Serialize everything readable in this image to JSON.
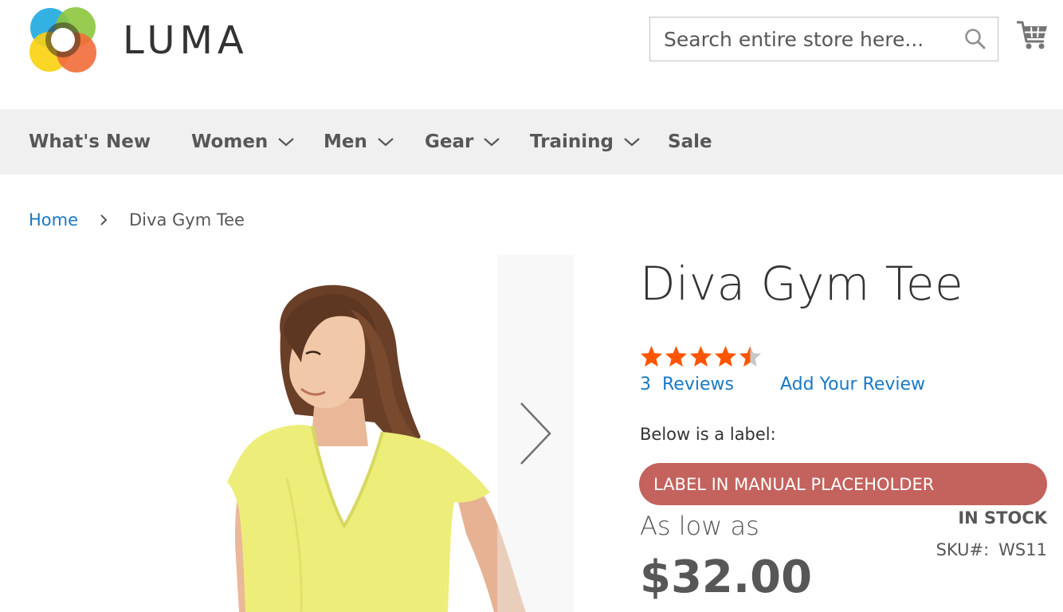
{
  "header": {
    "logo_text": "LUMA",
    "search": {
      "placeholder": "Search entire store here...",
      "value": ""
    },
    "icons": {
      "search": "search-icon",
      "cart": "shopping-cart-icon",
      "logo": "luma-logo-icon"
    }
  },
  "nav": {
    "items": [
      {
        "label": "What's New",
        "has_dropdown": false
      },
      {
        "label": "Women",
        "has_dropdown": true
      },
      {
        "label": "Men",
        "has_dropdown": true
      },
      {
        "label": "Gear",
        "has_dropdown": true
      },
      {
        "label": "Training",
        "has_dropdown": true
      },
      {
        "label": "Sale",
        "has_dropdown": false
      }
    ]
  },
  "breadcrumb": {
    "home": "Home",
    "current": "Diva Gym Tee"
  },
  "product": {
    "title": "Diva Gym Tee",
    "rating": {
      "value": 4.5,
      "max": 5
    },
    "reviews_count": "3",
    "reviews_label": "Reviews",
    "add_review": "Add Your Review",
    "label_caption": "Below is a label:",
    "label_text": "LABEL IN MANUAL PLACEHOLDER",
    "stock": "IN STOCK",
    "sku_label": "SKU#:",
    "sku_value": "WS11",
    "price_prefix": "As low as",
    "price": "$32.00"
  },
  "colors": {
    "link": "#1979c3",
    "star_filled": "#ff5501",
    "star_empty": "#c7c7c7",
    "label_bg": "#c4625d",
    "nav_bg": "#f0f0f0",
    "text_muted": "#575757"
  }
}
